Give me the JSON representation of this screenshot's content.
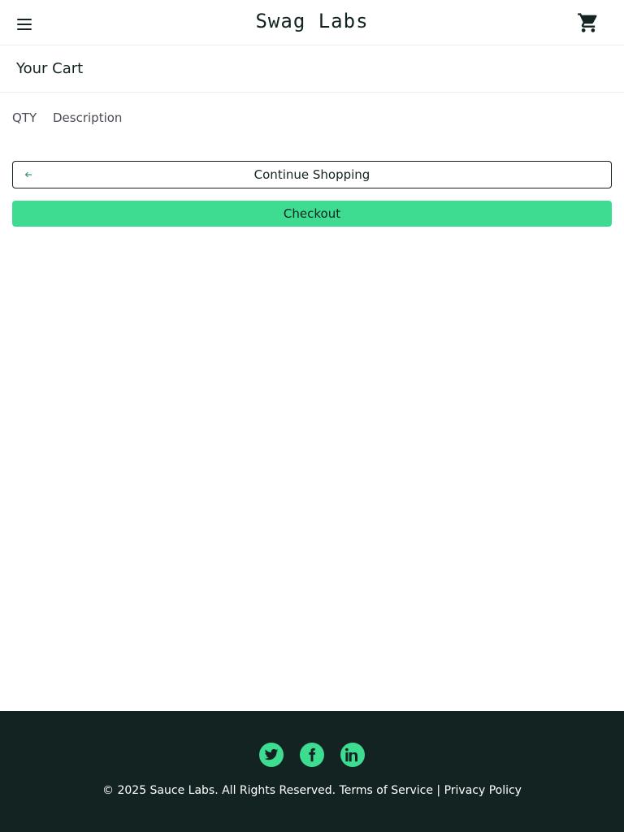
{
  "header": {
    "logo": "Swag Labs",
    "menu_icon": "hamburger-menu-icon",
    "cart_icon": "shopping-cart-icon"
  },
  "sub_header": {
    "title": "Your Cart"
  },
  "cart_list": {
    "qty_label": "QTY",
    "description_label": "Description",
    "items": []
  },
  "actions": {
    "continue_label": "Continue Shopping",
    "continue_icon": "arrow-left-icon",
    "checkout_label": "Checkout"
  },
  "footer": {
    "social": [
      "twitter-icon",
      "facebook-icon",
      "linkedin-icon"
    ],
    "copyright": "© 2025 Sauce Labs. All Rights Reserved. Terms of Service | Privacy Policy"
  },
  "colors": {
    "accent": "#3ddc91",
    "dark": "#132322",
    "text_muted": "#484c55"
  }
}
